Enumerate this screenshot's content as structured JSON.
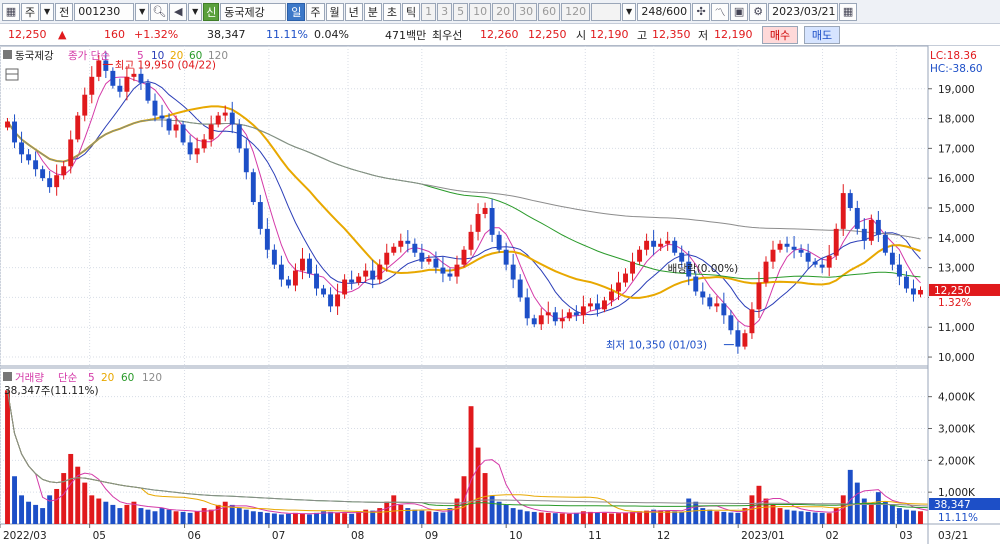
{
  "toolbar": {
    "market_label": "주",
    "prev_label": "전",
    "code": "001230",
    "new_badge": "신",
    "stock_name": "동국제강",
    "periods": [
      "일",
      "주",
      "월",
      "년",
      "분",
      "초",
      "틱"
    ],
    "selected_period": "일",
    "intervals": [
      "1",
      "3",
      "5",
      "10",
      "20",
      "30",
      "60",
      "120"
    ],
    "count": "248/600",
    "date": "2023/03/21"
  },
  "info": {
    "price": "12,250",
    "price_arrow": "▲",
    "change": "160",
    "change_pct": "+1.32%",
    "volume": "38,347",
    "vol_ratio": "11.11%",
    "turnover": "0.04%",
    "amount": "471백만",
    "best_label": "최우선",
    "best_ask": "12,260",
    "best_bid": "12,250",
    "open_label": "시",
    "open": "12,190",
    "high_label": "고",
    "high": "12,350",
    "low_label": "저",
    "low": "12,190",
    "buy_label": "매수",
    "sell_label": "매도"
  },
  "price_panel": {
    "legend_name": "동국제강",
    "legend_series": "종가 단순",
    "legend_periods": [
      "5",
      "10",
      "20",
      "60",
      "120"
    ],
    "lc_label": "LC:18.36",
    "hc_label": "HC:-38.60",
    "high_annotation": "최고 19,950 (04/22)",
    "low_annotation": "최저 10,350 (01/03)",
    "dividend_annotation": "배당락(0.00%)",
    "current_price_tag": "12,250",
    "current_pct_tag": "1.32%"
  },
  "volume_panel": {
    "legend_name": "거래량",
    "legend_series": "단순",
    "legend_periods": [
      "5",
      "20",
      "60",
      "120"
    ],
    "current_volume": "38,347주(11.11%)",
    "current_volume_tag": "38,347",
    "current_pct_tag": "11.11%"
  },
  "colors": {
    "up": "#e0191c",
    "down": "#1d4fc7",
    "ma5": "#d43aa8",
    "ma10": "#2c3fb8",
    "ma20": "#e8a800",
    "ma60": "#2a9a2a",
    "ma120": "#8c8c8c"
  },
  "chart_data": [
    {
      "type": "line",
      "title": "동국제강",
      "y_ticks": [
        10000,
        11000,
        12000,
        13000,
        14000,
        15000,
        16000,
        17000,
        18000,
        19000
      ],
      "ylim": [
        9700,
        20300
      ],
      "x_ticks": [
        "2022/03",
        "05",
        "06",
        "07",
        "08",
        "09",
        "10",
        "11",
        "12",
        "2023/01",
        "02",
        "03",
        "03/21"
      ],
      "series": [
        {
          "name": "종가",
          "values": [
            17900,
            17200,
            16800,
            16600,
            16300,
            16000,
            15700,
            16100,
            16400,
            17300,
            18100,
            18800,
            19400,
            19950,
            19600,
            19100,
            18900,
            19400,
            19500,
            19200,
            18600,
            18100,
            18000,
            17600,
            17800,
            17200,
            16800,
            17000,
            17300,
            17800,
            18100,
            18200,
            17800,
            17000,
            16200,
            15200,
            14300,
            13600,
            13100,
            12600,
            12400,
            12900,
            13300,
            12800,
            12300,
            12100,
            11700,
            12100,
            12600,
            12500,
            12700,
            12900,
            12600,
            13100,
            13500,
            13700,
            13900,
            13800,
            13500,
            13200,
            13300,
            13000,
            12800,
            12700,
            13100,
            13600,
            14200,
            14800,
            15000,
            14100,
            13600,
            13100,
            12600,
            12000,
            11300,
            11100,
            11400,
            11500,
            11200,
            11300,
            11500,
            11400,
            11700,
            11800,
            11600,
            11900,
            12200,
            12500,
            12800,
            13200,
            13600,
            13900,
            13700,
            13800,
            13900,
            13500,
            13200,
            12700,
            12200,
            12000,
            11700,
            11800,
            11400,
            10900,
            10350,
            10800,
            11600,
            12500,
            13200,
            13600,
            13800,
            13700,
            13600,
            13500,
            13200,
            13100,
            13000,
            13400,
            14300,
            15500,
            15000,
            14300,
            13900,
            14600,
            14100,
            13500,
            13100,
            12700,
            12300,
            12100,
            12250
          ]
        },
        {
          "name": "5"
        },
        {
          "name": "10"
        },
        {
          "name": "20"
        },
        {
          "name": "60"
        },
        {
          "name": "120"
        }
      ]
    },
    {
      "type": "bar",
      "title": "거래량",
      "y_ticks": [
        1000,
        2000,
        3000,
        4000
      ],
      "y_tick_labels": [
        "1,000K",
        "2,000K",
        "3,000K",
        "4,000K"
      ],
      "ylim": [
        0,
        4900
      ],
      "values": [
        4200,
        1500,
        900,
        700,
        600,
        500,
        900,
        1100,
        1600,
        2200,
        1800,
        1300,
        900,
        800,
        700,
        600,
        500,
        600,
        700,
        500,
        450,
        400,
        500,
        450,
        400,
        380,
        350,
        400,
        500,
        450,
        600,
        700,
        600,
        500,
        450,
        400,
        380,
        350,
        330,
        300,
        320,
        350,
        330,
        300,
        350,
        400,
        380,
        350,
        340,
        320,
        400,
        450,
        420,
        500,
        700,
        900,
        600,
        500,
        450,
        420,
        400,
        380,
        360,
        500,
        800,
        1500,
        3700,
        2400,
        1600,
        900,
        700,
        600,
        500,
        450,
        400,
        380,
        360,
        350,
        340,
        330,
        320,
        350,
        400,
        380,
        360,
        350,
        330,
        340,
        360,
        380,
        400,
        420,
        450,
        430,
        420,
        400,
        380,
        800,
        700,
        500,
        450,
        400,
        380,
        360,
        350,
        500,
        900,
        1200,
        800,
        600,
        500,
        450,
        420,
        400,
        380,
        360,
        350,
        340,
        500,
        900,
        1700,
        1300,
        800,
        600,
        1000,
        700,
        600,
        500,
        450,
        420,
        400,
        380
      ]
    }
  ]
}
